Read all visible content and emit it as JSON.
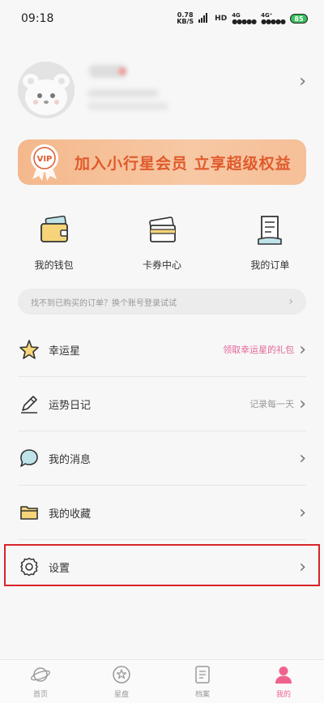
{
  "status_bar": {
    "time": "09:18",
    "net_speed": "0.78",
    "net_unit": "KB/S",
    "hd": "HD",
    "sig1": "4G",
    "sig2": "4G⁺",
    "dots": "●●●●●",
    "battery": "85"
  },
  "vip_banner": {
    "text": "加入小行星会员 立享超级权益",
    "medal_text": "VIP"
  },
  "quick": [
    {
      "label": "我的钱包",
      "icon": "wallet-icon"
    },
    {
      "label": "卡券中心",
      "icon": "card-icon"
    },
    {
      "label": "我的订单",
      "icon": "order-icon"
    }
  ],
  "hint": {
    "text": "找不到已购买的订单？换个账号登录试试"
  },
  "menu": [
    {
      "label": "幸运星",
      "extra": "领取幸运星的礼包",
      "icon": "star-icon"
    },
    {
      "label": "运势日记",
      "extra": "记录每一天",
      "icon": "pencil-icon"
    },
    {
      "label": "我的消息",
      "extra": "",
      "icon": "message-icon"
    },
    {
      "label": "我的收藏",
      "extra": "",
      "icon": "folder-icon"
    },
    {
      "label": "设置",
      "extra": "",
      "icon": "gear-icon"
    }
  ],
  "tabbar": [
    {
      "label": "首页",
      "icon": "planet-icon"
    },
    {
      "label": "星盘",
      "icon": "astro-chart-icon"
    },
    {
      "label": "档案",
      "icon": "archive-icon"
    },
    {
      "label": "我的",
      "icon": "profile-icon"
    }
  ],
  "colors": {
    "accent": "#f0628e",
    "vip_text": "#e05a2c",
    "highlight": "#d8232a"
  }
}
